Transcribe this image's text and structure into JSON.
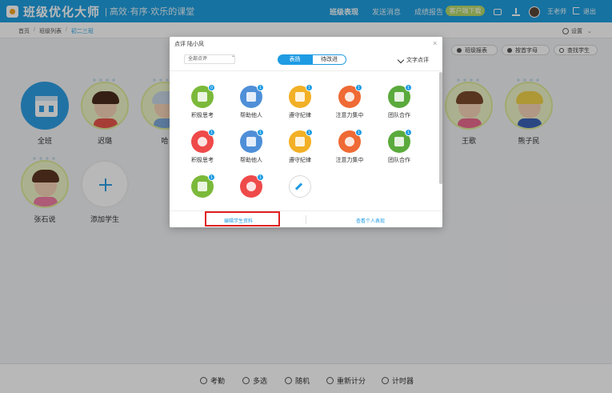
{
  "header": {
    "brand": "班级优化大师",
    "slogan": "| 高效·有序·欢乐的课堂",
    "nav": [
      "班级表现",
      "发送消息",
      "成绩报告"
    ],
    "download_label": "客户端下载",
    "user_name": "王老师",
    "logout_label": "退出"
  },
  "breadcrumb": {
    "items": [
      "首页",
      "班级列表",
      "初二三班"
    ],
    "separator": "/"
  },
  "settings": {
    "label": "设置",
    "caret": "⌄"
  },
  "toolbar": {
    "report_label": "班级报表",
    "sort_label": "按首字母",
    "search_label": "查找学生"
  },
  "students": [
    {
      "name": "全班",
      "kind": "all"
    },
    {
      "name": "迟璐",
      "kind": "student"
    },
    {
      "name": "哈",
      "kind": "student"
    },
    {
      "name": "王歌",
      "kind": "student"
    },
    {
      "name": "熊子民",
      "kind": "student"
    },
    {
      "name": "张石说",
      "kind": "student"
    },
    {
      "name": "添加学生",
      "kind": "add"
    }
  ],
  "bottom": {
    "items": [
      "考勤",
      "多选",
      "随机",
      "重新计分",
      "计时器"
    ]
  },
  "dialog": {
    "title": "点评 陆小凤",
    "close": "×",
    "filter": {
      "value": "全部点评",
      "caret": "⌃"
    },
    "tabs": [
      "表扬",
      "待改进"
    ],
    "active_tab": "表扬",
    "text_review_label": "文字点评",
    "items": [
      {
        "label": "积极思考",
        "badge": "0",
        "icon": "thinking-icon",
        "color": "#7bb93a"
      },
      {
        "label": "帮助他人",
        "badge": "1",
        "icon": "handshake-icon",
        "color": "#4f8fd8"
      },
      {
        "label": "遵守纪律",
        "badge": "1",
        "icon": "rule-shield-icon",
        "color": "#f2b025"
      },
      {
        "label": "注意力集中",
        "badge": "1",
        "icon": "target-icon",
        "color": "#ef6a35"
      },
      {
        "label": "团队合作",
        "badge": "1",
        "icon": "puzzle-icon",
        "color": "#5aaa3c"
      },
      {
        "label": "积极思考",
        "badge": "1",
        "icon": "lightbulb-icon",
        "color": "#ef4a4a"
      },
      {
        "label": "帮助他人",
        "badge": "1",
        "icon": "handshake-icon",
        "color": "#4f8fd8"
      },
      {
        "label": "遵守纪律",
        "badge": "1",
        "icon": "rule-shield-icon",
        "color": "#f2b025"
      },
      {
        "label": "注意力集中",
        "badge": "1",
        "icon": "target-icon",
        "color": "#ef6a35"
      },
      {
        "label": "团队合作",
        "badge": "1",
        "icon": "puzzle-icon",
        "color": "#5aaa3c"
      },
      {
        "label": "",
        "badge": "1",
        "icon": "thinking-icon",
        "color": "#7bb93a"
      },
      {
        "label": "",
        "badge": "1",
        "icon": "lightbulb-icon",
        "color": "#ef4a4a"
      }
    ],
    "footer": {
      "edit_label": "编辑学生资料",
      "view_label": "查看个人表现"
    }
  }
}
